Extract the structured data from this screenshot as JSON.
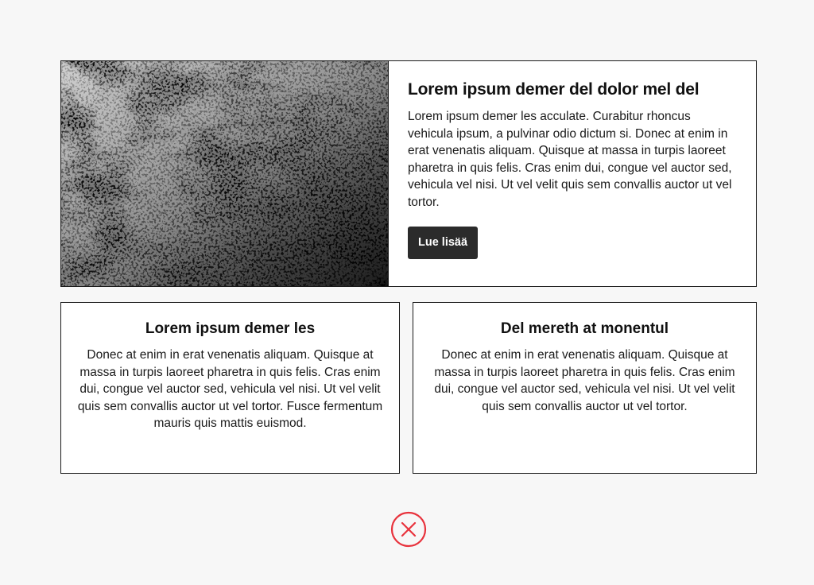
{
  "hero": {
    "title": "Lorem ipsum demer del dolor mel del",
    "text": "Lorem ipsum demer les acculate. Curabitur rhoncus vehicula ipsum, a pulvinar odio dictum si. Donec at enim in erat venenatis aliquam. Quisque at massa in turpis laoreet pharetra in quis felis. Cras enim dui, congue vel auctor sed, vehicula vel nisi. Ut vel velit quis sem convallis auctor ut vel tortor.",
    "button_label": "Lue lisää",
    "image": "abstract-marble-image"
  },
  "cards": [
    {
      "title": "Lorem ipsum demer les",
      "text": "Donec at enim in erat venenatis aliquam. Quisque at massa in turpis laoreet pharetra in quis felis. Cras enim dui, congue vel auctor sed, vehicula vel nisi. Ut vel velit quis sem convallis auctor ut vel tortor. Fusce fermentum mauris quis mattis euismod."
    },
    {
      "title": "Del mereth at monentul",
      "text": "Donec at enim in erat venenatis aliquam. Quisque at massa in turpis laoreet pharetra in quis felis. Cras enim dui, congue vel auctor sed, vehicula vel nisi. Ut vel velit quis sem convallis auctor ut vel tortor."
    }
  ],
  "status_icon": {
    "name": "error-x-circle-icon",
    "color": "#e8323c"
  },
  "colors": {
    "background": "#f7f7f7",
    "button": "#2b2b2b",
    "border": "#1a1a1a"
  }
}
